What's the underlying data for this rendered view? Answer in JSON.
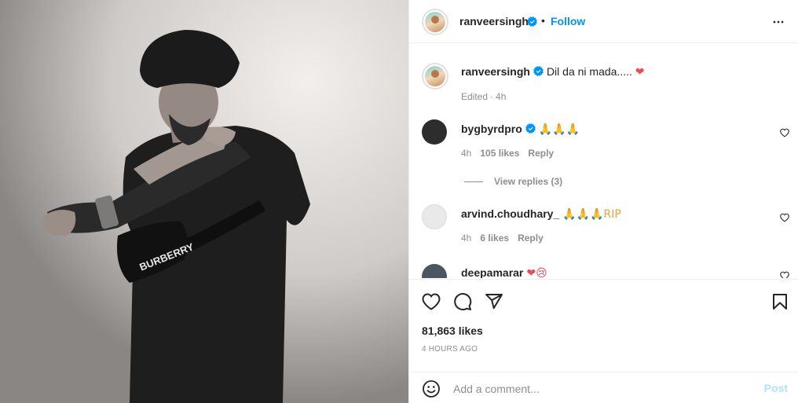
{
  "post": {
    "image_alt": "Black and white photo of a man in a turban posing"
  },
  "header": {
    "username": "ranveersingh",
    "separator": "•",
    "follow_label": "Follow"
  },
  "caption": {
    "username": "ranveersingh",
    "text": "Dil da ni mada.....",
    "emoji": "❤",
    "edited": "Edited",
    "time": "4h"
  },
  "comments": [
    {
      "username": "bygbyrdpro",
      "verified": true,
      "text": "🙏🙏🙏",
      "time": "4h",
      "likes": "105 likes",
      "reply": "Reply"
    },
    {
      "username": "arvind.choudhary_",
      "verified": false,
      "text": "🙏🙏🙏RIP",
      "time": "4h",
      "likes": "6 likes",
      "reply": "Reply"
    },
    {
      "username": "deepamarar",
      "verified": false,
      "text": "❤😢"
    }
  ],
  "view_replies": "View replies (3)",
  "actions": {
    "likes": "81,863 likes",
    "timestamp": "4 HOURS AGO"
  },
  "add_comment": {
    "placeholder": "Add a comment...",
    "post_label": "Post"
  },
  "colors": {
    "accent": "#0095f6",
    "muted": "#8e8e8e",
    "heart": "#ed4956",
    "post_disabled": "#b2dffc"
  },
  "icons": [
    "more-icon",
    "verified-icon",
    "heart-icon",
    "comment-icon",
    "share-icon",
    "save-icon",
    "emoji-icon"
  ]
}
